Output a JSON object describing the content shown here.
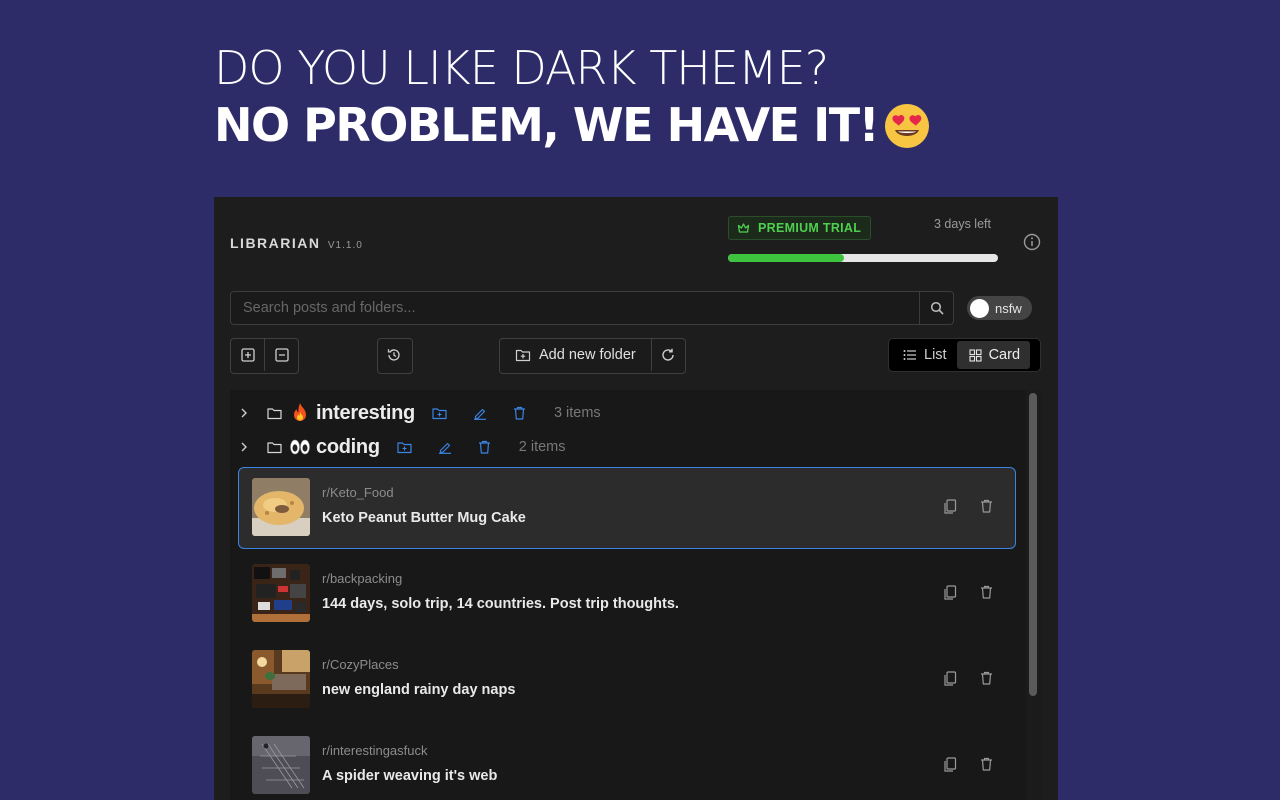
{
  "hero": {
    "line1": "DO YOU LIKE DARK THEME?",
    "line2": "NO PROBLEM, WE HAVE IT!"
  },
  "app": {
    "name": "LIBRARIAN",
    "version": "V1.1.0",
    "premium_label": "PREMIUM TRIAL",
    "days_left": "3 days left",
    "trial_progress": 0.43,
    "colors": {
      "accent_green": "#3ec33e",
      "selected_border": "#3a84e3",
      "background": "#2d2c69"
    }
  },
  "search": {
    "placeholder": "Search posts and folders...",
    "value": ""
  },
  "nsfw": {
    "label": "nsfw",
    "enabled": false
  },
  "toolbar": {
    "add_folder_label": "Add new folder",
    "view_list_label": "List",
    "view_card_label": "Card",
    "active_view": "Card"
  },
  "folders": [
    {
      "emoji": "fire",
      "name": "interesting",
      "count": "3 items"
    },
    {
      "emoji": "eyes",
      "name": "coding",
      "count": "2 items"
    }
  ],
  "posts": [
    {
      "subreddit": "r/Keto_Food",
      "title": "Keto Peanut Butter Mug Cake",
      "selected": true
    },
    {
      "subreddit": "r/backpacking",
      "title": "144 days, solo trip, 14 countries. Post trip thoughts.",
      "selected": false
    },
    {
      "subreddit": "r/CozyPlaces",
      "title": "new england rainy day naps",
      "selected": false
    },
    {
      "subreddit": "r/interestingasfuck",
      "title": "A spider weaving it's web",
      "selected": false
    }
  ]
}
